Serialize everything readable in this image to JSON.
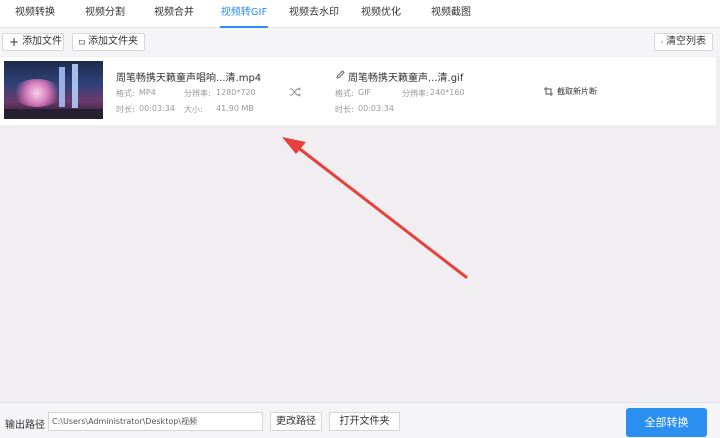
{
  "tabs": [
    {
      "label": "视频转换",
      "active": false
    },
    {
      "label": "视频分割",
      "active": false
    },
    {
      "label": "视频合并",
      "active": false
    },
    {
      "label": "视频转GIF",
      "active": true
    },
    {
      "label": "视频去水印",
      "active": false
    },
    {
      "label": "视频优化",
      "active": false
    },
    {
      "label": "视频截图",
      "active": false
    }
  ],
  "toolbar": {
    "add_file": "添加文件",
    "add_folder": "添加文件夹",
    "clear_list": "清空列表"
  },
  "item": {
    "source": {
      "filename": "周笔畅携天籁童声唱响...清.mp4",
      "format_label": "格式:",
      "format": "MP4",
      "resolution_label": "分辨率:",
      "resolution": "1280*720",
      "duration_label": "时长:",
      "duration": "00:03:34",
      "size_label": "大小:",
      "size": "41.90 MB"
    },
    "output": {
      "filename": "周笔畅携天籁童声...清.gif",
      "format_label": "格式:",
      "format": "GIF",
      "resolution_label": "分辨率:",
      "resolution": "240*160",
      "duration_label": "时长:",
      "duration": "00:03:34"
    },
    "crop_label": "截取新片断"
  },
  "bottom": {
    "output_path_label": "输出路径",
    "output_path_value": "C:\\Users\\Administrator\\Desktop\\视频",
    "change_path": "更改路径",
    "open_folder": "打开文件夹",
    "convert_all": "全部转换"
  },
  "colors": {
    "accent": "#2b8ff2",
    "annotation_arrow": "#e8403a"
  }
}
